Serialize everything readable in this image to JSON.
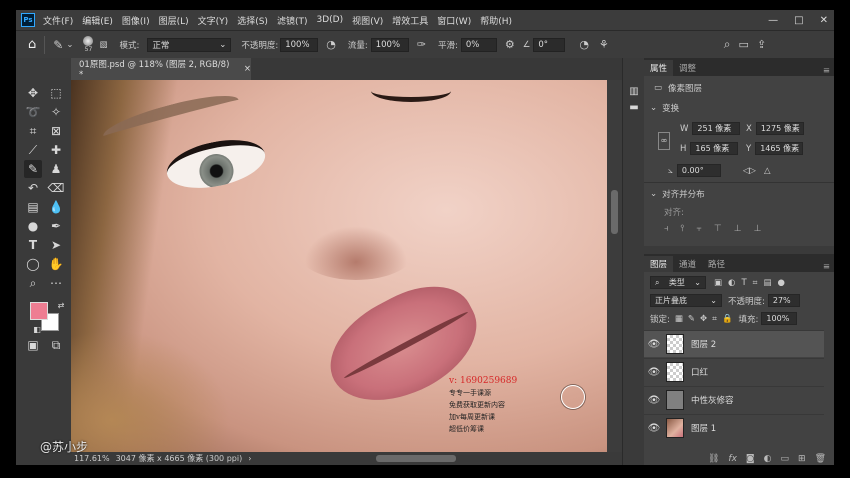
{
  "app": {
    "logo": "Ps"
  },
  "menu": [
    "文件(F)",
    "编辑(E)",
    "图像(I)",
    "图层(L)",
    "文字(Y)",
    "选择(S)",
    "滤镜(T)",
    "3D(D)",
    "视图(V)",
    "增效工具",
    "窗口(W)",
    "帮助(H)"
  ],
  "window_controls": {
    "minimize": "—",
    "maximize": "□",
    "close": "✕"
  },
  "options": {
    "home_icon": "home-icon",
    "brush_size": "57",
    "mode_label": "模式:",
    "mode_value": "正常",
    "opacity_label": "不透明度:",
    "opacity_value": "100%",
    "flow_label": "流量:",
    "flow_value": "100%",
    "smoothing_label": "平滑:",
    "smoothing_value": "0%",
    "angle_value": "0°"
  },
  "document": {
    "tab_title": "01原图.psd @ 118% (图层 2, RGB/8) *",
    "close": "×"
  },
  "canvas": {
    "promo_lines": [
      "v: 1690259689",
      "专专一手课源",
      "免费获取更新内容",
      "加v每周更新课",
      "超低价筹课"
    ]
  },
  "status": {
    "zoom": "117.61%",
    "info": "3047 像素 x 4665 像素 (300 ppi)"
  },
  "watermark": "@苏小步",
  "properties": {
    "tabs": [
      "属性",
      "调整"
    ],
    "type_label": "像素图层",
    "transform_title": "变换",
    "w_label": "W",
    "w_value": "251 像素",
    "x_label": "X",
    "x_value": "1275 像素",
    "h_label": "H",
    "h_value": "165 像素",
    "y_label": "Y",
    "y_value": "1465 像素",
    "angle_value": "0.00°",
    "align_title": "对齐并分布",
    "align_label": "对齐:"
  },
  "layers_panel": {
    "tabs": [
      "图层",
      "通道",
      "路径"
    ],
    "filter_kind": "类型",
    "blend_mode": "正片叠底",
    "opacity_label": "不透明度:",
    "opacity_value": "27%",
    "lock_label": "锁定:",
    "fill_label": "填充:",
    "fill_value": "100%",
    "layers": [
      {
        "name": "图层 2",
        "thumb": "checker",
        "selected": true
      },
      {
        "name": "口红",
        "thumb": "checker",
        "selected": false
      },
      {
        "name": "中性灰修容",
        "thumb": "grey",
        "selected": false
      },
      {
        "name": "图层 1",
        "thumb": "photo",
        "selected": false
      }
    ]
  },
  "colors": {
    "foreground": "#ee7d92",
    "background": "#ffffff"
  }
}
